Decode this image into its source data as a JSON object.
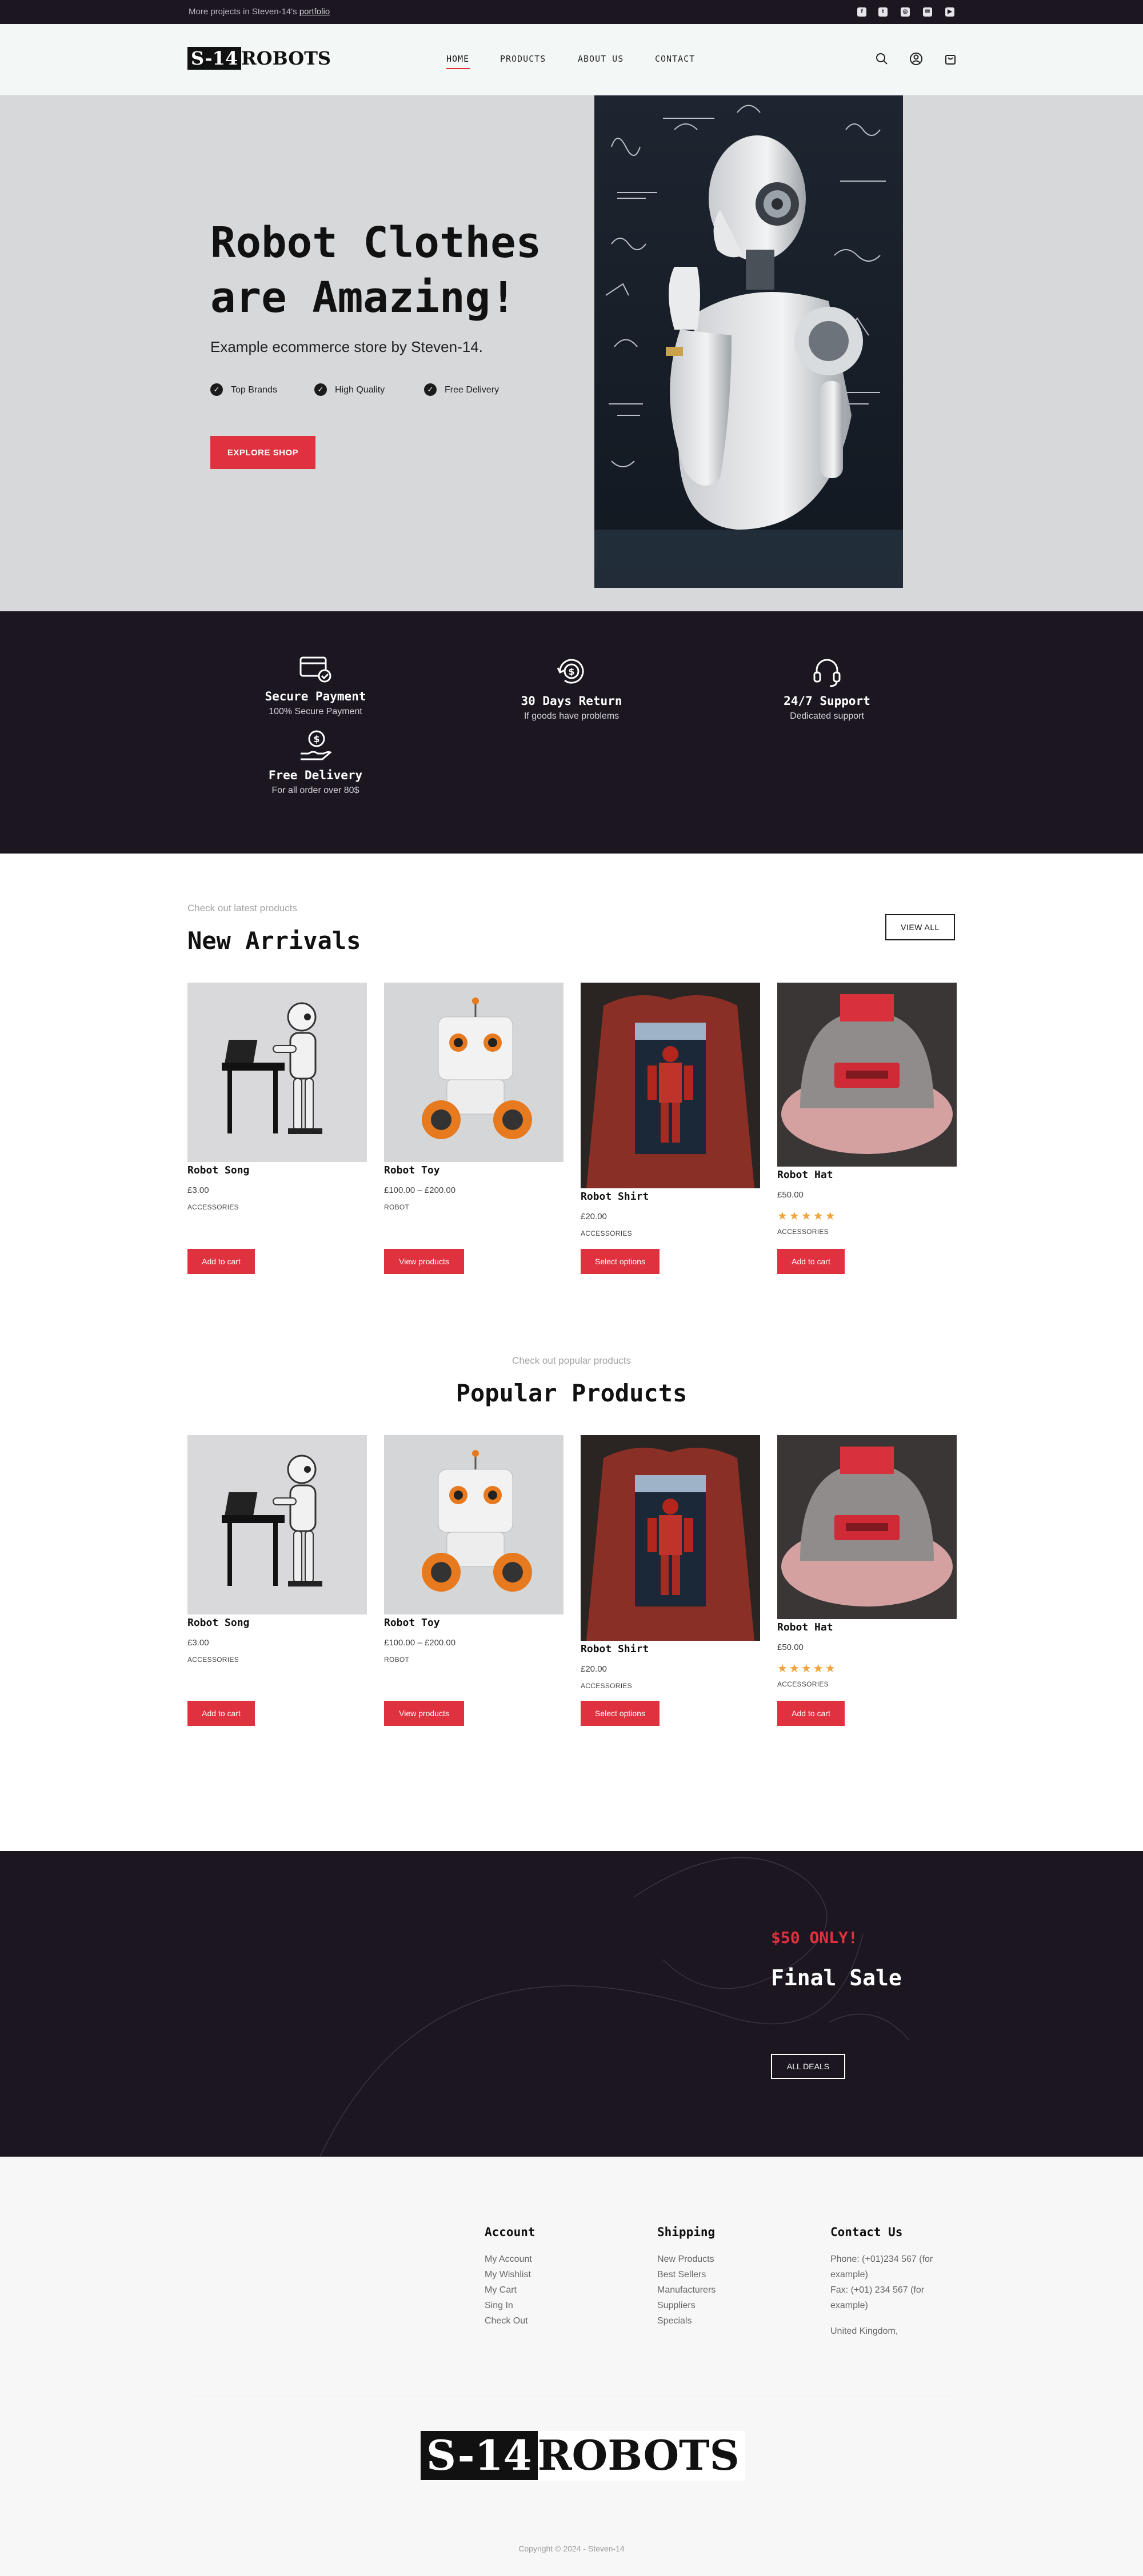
{
  "topbar": {
    "message_prefix": "More projects in Steven-14's",
    "message_link": "portfolio",
    "social": [
      "facebook-icon",
      "twitter-icon",
      "instagram-icon",
      "mail-icon",
      "youtube-icon"
    ]
  },
  "header": {
    "logo_box": "S-14",
    "logo_text": "ROBOTS",
    "nav": [
      "HOME",
      "PRODUCTS",
      "ABOUT US",
      "CONTACT"
    ],
    "active_nav": "HOME"
  },
  "hero": {
    "title_line1": "Robot Clothes",
    "title_line2": "are Amazing!",
    "subtitle": "Example ecommerce store by Steven-14.",
    "features": [
      "Top Brands",
      "High Quality",
      "Free Delivery"
    ],
    "cta": "EXPLORE SHOP"
  },
  "services": [
    {
      "title": "Secure Payment",
      "desc": "100% Secure Payment",
      "icon": "credit-card-icon"
    },
    {
      "title": "30 Days Return",
      "desc": "If goods have problems",
      "icon": "money-return-icon"
    },
    {
      "title": "24/7 Support",
      "desc": "Dedicated support",
      "icon": "headset-icon"
    },
    {
      "title": "Free Delivery",
      "desc": "For all order over 80$",
      "icon": "hand-dollar-icon"
    }
  ],
  "new_arrivals": {
    "kicker": "Check out latest products",
    "title": "New Arrivals",
    "view_all": "VIEW ALL"
  },
  "popular": {
    "kicker": "Check out popular products",
    "title": "Popular Products"
  },
  "products": [
    {
      "name": "Robot Song",
      "price": "£3.00",
      "category": "ACCESSORIES",
      "button": "Add to cart",
      "stars": 0
    },
    {
      "name": "Robot Toy",
      "price": "£100.00 – £200.00",
      "category": "ROBOT",
      "button": "View products",
      "stars": 0
    },
    {
      "name": "Robot Shirt",
      "price": "£20.00",
      "category": "ACCESSORIES",
      "button": "Select options",
      "stars": 0
    },
    {
      "name": "Robot Hat",
      "price": "£50.00",
      "category": "ACCESSORIES",
      "button": "Add to cart",
      "stars": 5,
      "stars_text": "★★★★★"
    }
  ],
  "sale": {
    "price": "$50 ONLY!",
    "title": "Final Sale",
    "button": "ALL DEALS"
  },
  "footer": {
    "account": {
      "title": "Account",
      "links": [
        "My Account",
        "My Wishlist",
        "My Cart",
        "Sing In",
        "Check Out"
      ]
    },
    "shipping": {
      "title": "Shipping",
      "links": [
        "New Products",
        "Best Sellers",
        "Manufacturers",
        "Suppliers",
        "Specials"
      ]
    },
    "contact": {
      "title": "Contact Us",
      "phone": "Phone: (+01)234 567 (for example)",
      "fax": "Fax: (+01) 234 567 (for example)",
      "location": "United Kingdom,"
    },
    "copyright": "Copyright © 2024 - Steven-14"
  },
  "colors": {
    "accent": "#e0313f",
    "dark": "#1b1620",
    "hero_bg": "#d6d8da",
    "star": "#f2a33a"
  }
}
